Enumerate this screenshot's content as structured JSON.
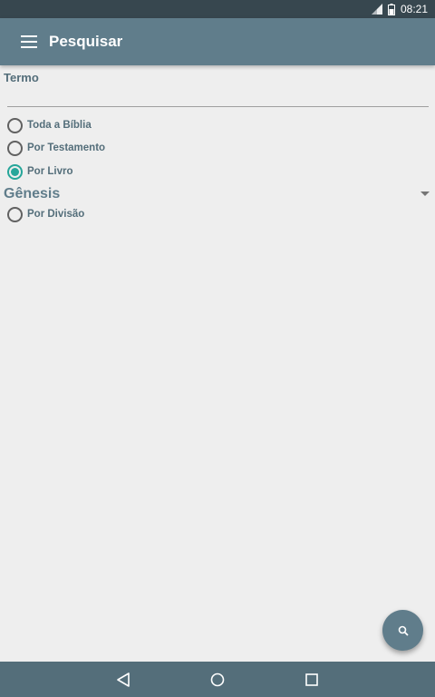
{
  "status_bar": {
    "time": "08:21",
    "icons": [
      "signal-icon",
      "battery-icon"
    ]
  },
  "app_bar": {
    "title": "Pesquisar",
    "menu_icon": "hamburger-menu-icon"
  },
  "search": {
    "term_label": "Termo",
    "term_value": "",
    "scope_options": [
      {
        "label": "Toda a Bíblia",
        "checked": false
      },
      {
        "label": "Por Testamento",
        "checked": false
      },
      {
        "label": "Por Livro",
        "checked": true
      },
      {
        "label": "Por Divisão",
        "checked": false
      }
    ],
    "book_selected": "Gênesis"
  },
  "fab": {
    "icon": "search-icon"
  },
  "nav_bar": {
    "icons": [
      "back-icon",
      "home-icon",
      "recents-icon"
    ]
  },
  "colors": {
    "app_bar": "#607d8b",
    "status_bar": "#37474f",
    "nav_bar": "#546e7a",
    "accent": "#26a69a",
    "background": "#eeeeee"
  }
}
